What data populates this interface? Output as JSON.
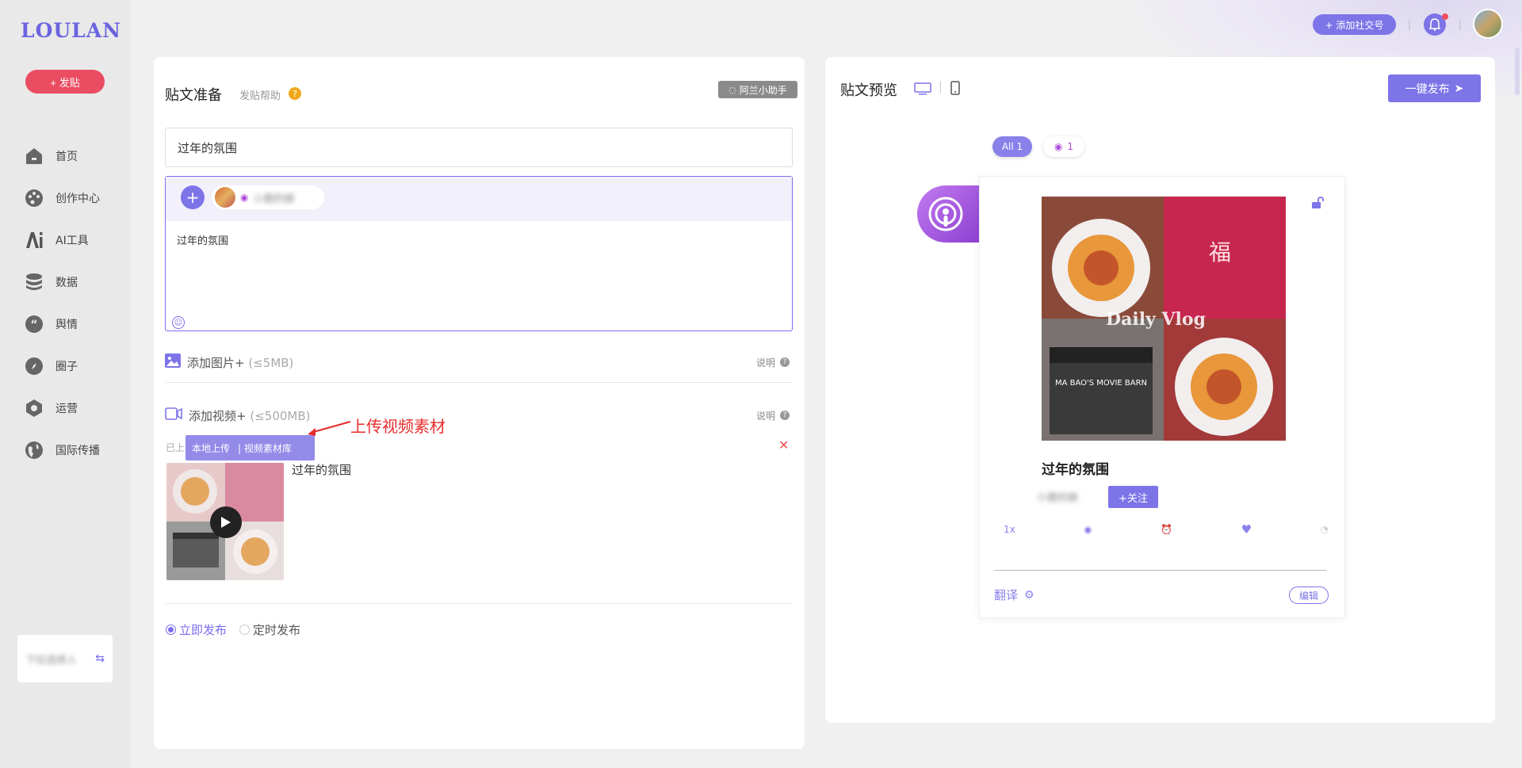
{
  "brand": {
    "logo": "LOULAN",
    "accent": "#7d74e8",
    "post_button_color": "#ea4c62"
  },
  "sidebar": {
    "post_button": "+ 发贴",
    "items": [
      {
        "label": "首页",
        "icon": "home-icon"
      },
      {
        "label": "创作中心",
        "icon": "palette-icon"
      },
      {
        "label": "AI工具",
        "icon": "ai-icon"
      },
      {
        "label": "数据",
        "icon": "database-icon"
      },
      {
        "label": "舆情",
        "icon": "quote-icon"
      },
      {
        "label": "圈子",
        "icon": "compass-icon"
      },
      {
        "label": "运营",
        "icon": "operations-icon"
      },
      {
        "label": "国际传播",
        "icon": "globe-icon"
      }
    ],
    "user_box": "下拉选择人"
  },
  "topbar": {
    "add_social": "+ 添加社交号",
    "sep": "|"
  },
  "editor": {
    "title": "贴文准备",
    "help": "发贴帮助",
    "help_mark": "?",
    "assistant": "阿兰小助手",
    "title_value": "过年的氛围",
    "account_name": "小鹿的娘",
    "body_text": "过年的氛围",
    "add_image": "添加图片+",
    "image_limit": "(≤5MB)",
    "add_video": "添加视频+",
    "video_limit": "(≤500MB)",
    "explain": "说明",
    "uploaded_prefix": "已上",
    "local_upload": "本地上传",
    "video_library": "| 视频素材库",
    "annotation": "上传视频素材",
    "video_title": "过年的氛围",
    "publish_now": "立即发布",
    "publish_scheduled": "定时发布"
  },
  "preview": {
    "title": "贴文预览",
    "publish_button": "一键发布",
    "filter_all": "All 1",
    "filter_podcast_count": "1",
    "card_title": "过年的氛围",
    "author": "小鹿的娘",
    "follow": "+关注",
    "speed": "1x",
    "cover_text": "Daily Vlog",
    "clapboard_text": "MA BAO'S MOVIE BARN",
    "fu_char": "福",
    "translate": "翻译",
    "edit": "编辑"
  }
}
